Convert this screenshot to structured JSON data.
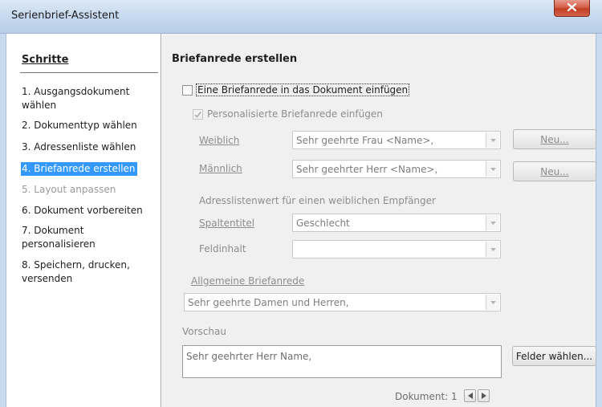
{
  "window": {
    "title": "Serienbrief-Assistent",
    "close_icon": "close-icon"
  },
  "sidebar": {
    "heading": "Schritte",
    "steps": [
      {
        "number": "1.",
        "label": "Ausgangsdokument wählen",
        "state": "normal"
      },
      {
        "number": "2.",
        "label": "Dokumenttyp wählen",
        "state": "normal"
      },
      {
        "number": "3.",
        "label": "Adressenliste wählen",
        "state": "normal"
      },
      {
        "number": "4.",
        "label": "Briefanrede erstellen",
        "state": "active"
      },
      {
        "number": "5.",
        "label": "Layout anpassen",
        "state": "disabled"
      },
      {
        "number": "6.",
        "label": "Dokument vorbereiten",
        "state": "normal"
      },
      {
        "number": "7.",
        "label": "Dokument personalisieren",
        "state": "normal"
      },
      {
        "number": "8.",
        "label": "Speichern, drucken, versenden",
        "state": "normal"
      }
    ]
  },
  "main": {
    "title": "Briefanrede erstellen",
    "insert_salutation": {
      "label": "Eine Briefanrede in das Dokument einfügen",
      "checked": false
    },
    "personalized": {
      "label": "Personalisierte Briefanrede einfügen",
      "checked": true
    },
    "female": {
      "label": "Weiblich",
      "value": "Sehr geehrte Frau <Name>,",
      "new_button": "Neu..."
    },
    "male": {
      "label": "Männlich",
      "value": "Sehr geehrter Herr <Name>,",
      "new_button": "Neu..."
    },
    "address_list_caption": "Adresslistenwert für einen weiblichen Empfänger",
    "column_title": {
      "label": "Spaltentitel",
      "value": "Geschlecht"
    },
    "field_content": {
      "label": "Feldinhalt",
      "value": ""
    },
    "general": {
      "label": "Allgemeine Briefanrede",
      "value": "Sehr geehrte Damen und Herren,"
    },
    "preview": {
      "label": "Vorschau",
      "text": "Sehr geehrter Herr Name,",
      "fields_button": "Felder wählen..."
    },
    "document_nav": {
      "label": "Dokument:",
      "number": "1"
    }
  },
  "colors": {
    "selection": "#3399ff",
    "disabled_text": "#8d8d8d",
    "close_button": "#c13f24"
  }
}
